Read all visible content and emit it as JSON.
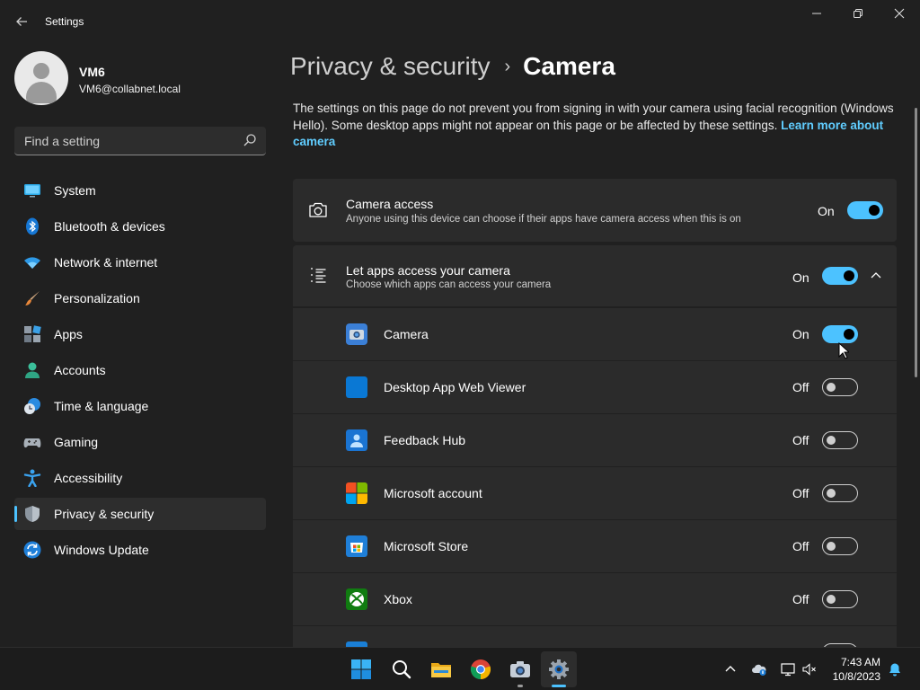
{
  "window": {
    "title": "Settings",
    "back_icon": "arrow-left-icon",
    "minimize_icon": "minimize-icon",
    "maximize_icon": "restore-icon",
    "close_icon": "close-icon"
  },
  "profile": {
    "name": "VM6",
    "email": "VM6@collabnet.local"
  },
  "search": {
    "placeholder": "Find a setting"
  },
  "sidebar": {
    "items": [
      {
        "label": "System",
        "icon": "system-icon"
      },
      {
        "label": "Bluetooth & devices",
        "icon": "bluetooth-icon"
      },
      {
        "label": "Network & internet",
        "icon": "wifi-icon"
      },
      {
        "label": "Personalization",
        "icon": "brush-icon"
      },
      {
        "label": "Apps",
        "icon": "apps-icon"
      },
      {
        "label": "Accounts",
        "icon": "accounts-icon"
      },
      {
        "label": "Time & language",
        "icon": "time-language-icon"
      },
      {
        "label": "Gaming",
        "icon": "gamepad-icon"
      },
      {
        "label": "Accessibility",
        "icon": "accessibility-icon"
      },
      {
        "label": "Privacy & security",
        "icon": "shield-icon",
        "selected": true
      },
      {
        "label": "Windows Update",
        "icon": "update-icon"
      }
    ]
  },
  "breadcrumb": {
    "parent": "Privacy & security",
    "separator": "›",
    "current": "Camera"
  },
  "description": {
    "text": "The settings on this page do not prevent you from signing in with your camera using facial recognition (Windows Hello). Some desktop apps might not appear on this page or be affected by these settings.",
    "link": "Learn more about camera"
  },
  "camera_access": {
    "title": "Camera access",
    "subtitle": "Anyone using this device can choose if their apps have camera access when this is on",
    "state": "On"
  },
  "apps_access": {
    "title": "Let apps access your camera",
    "subtitle": "Choose which apps can access your camera",
    "state": "On"
  },
  "apps": [
    {
      "name": "Camera",
      "state": "On",
      "icon": "camera-app-icon"
    },
    {
      "name": "Desktop App Web Viewer",
      "state": "Off",
      "icon": "web-viewer-icon"
    },
    {
      "name": "Feedback Hub",
      "state": "Off",
      "icon": "feedback-hub-icon"
    },
    {
      "name": "Microsoft account",
      "state": "Off",
      "icon": "microsoft-logo-icon"
    },
    {
      "name": "Microsoft Store",
      "state": "Off",
      "icon": "store-icon"
    },
    {
      "name": "Xbox",
      "state": "Off",
      "icon": "xbox-icon"
    }
  ],
  "taskbar": {
    "icons": [
      "windows-start-icon",
      "search-icon",
      "file-explorer-icon",
      "chrome-icon",
      "camera-taskbar-icon",
      "settings-gear-icon"
    ],
    "time": "7:43 AM",
    "date": "10/8/2023"
  },
  "colors": {
    "accent": "#4cc2ff",
    "link": "#60cdff",
    "background": "#202020",
    "card": "#2b2b2b"
  }
}
